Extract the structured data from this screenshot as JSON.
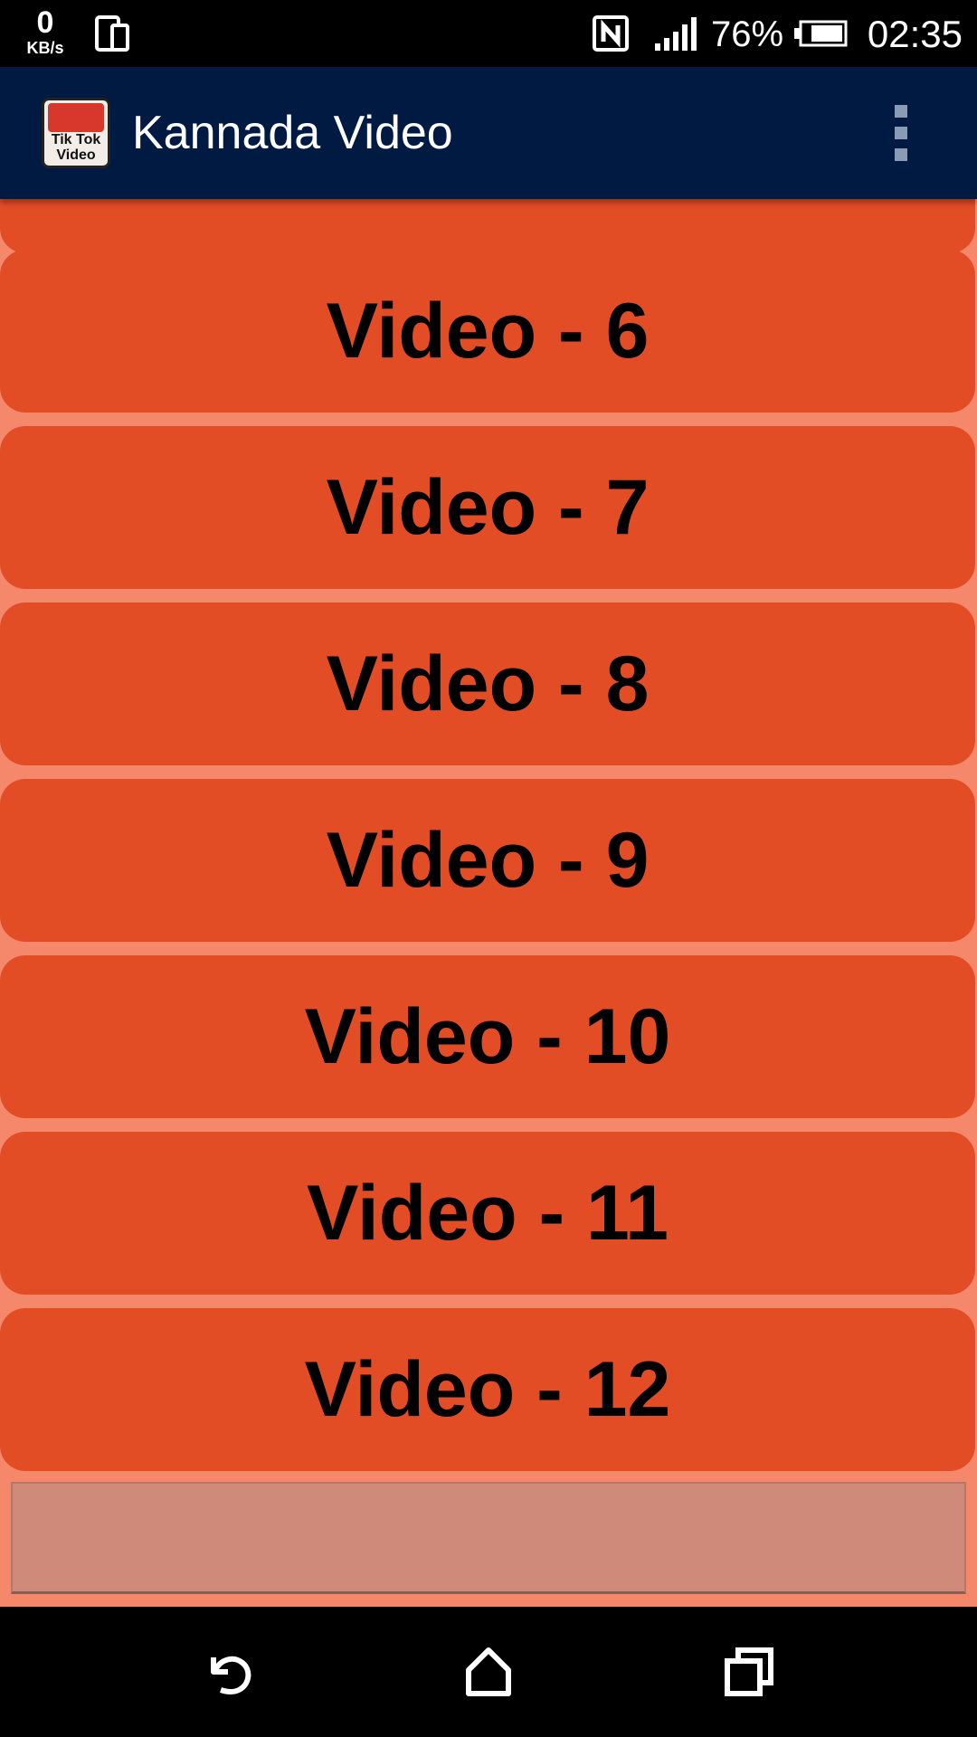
{
  "status_bar": {
    "speed_value": "0",
    "speed_unit": "KB/s",
    "battery_percent": "76%",
    "time": "02:35",
    "icons": [
      "device-icon",
      "nfc-icon",
      "signal-icon",
      "battery-icon"
    ]
  },
  "app_bar": {
    "title": "Kannada Video",
    "logo_lines": [
      "Tik Tok",
      "Video"
    ],
    "background_color": "#001a42",
    "menu_icon": "overflow-menu-icon"
  },
  "list": {
    "item_color": "#e34d26",
    "background_color": "#f5876a",
    "items": [
      {
        "label": "Video - 6"
      },
      {
        "label": "Video - 7"
      },
      {
        "label": "Video - 8"
      },
      {
        "label": "Video - 9"
      },
      {
        "label": "Video - 10"
      },
      {
        "label": "Video - 11"
      },
      {
        "label": "Video - 12"
      }
    ]
  },
  "nav_bar": {
    "buttons": [
      "back-icon",
      "home-icon",
      "recents-icon"
    ]
  }
}
